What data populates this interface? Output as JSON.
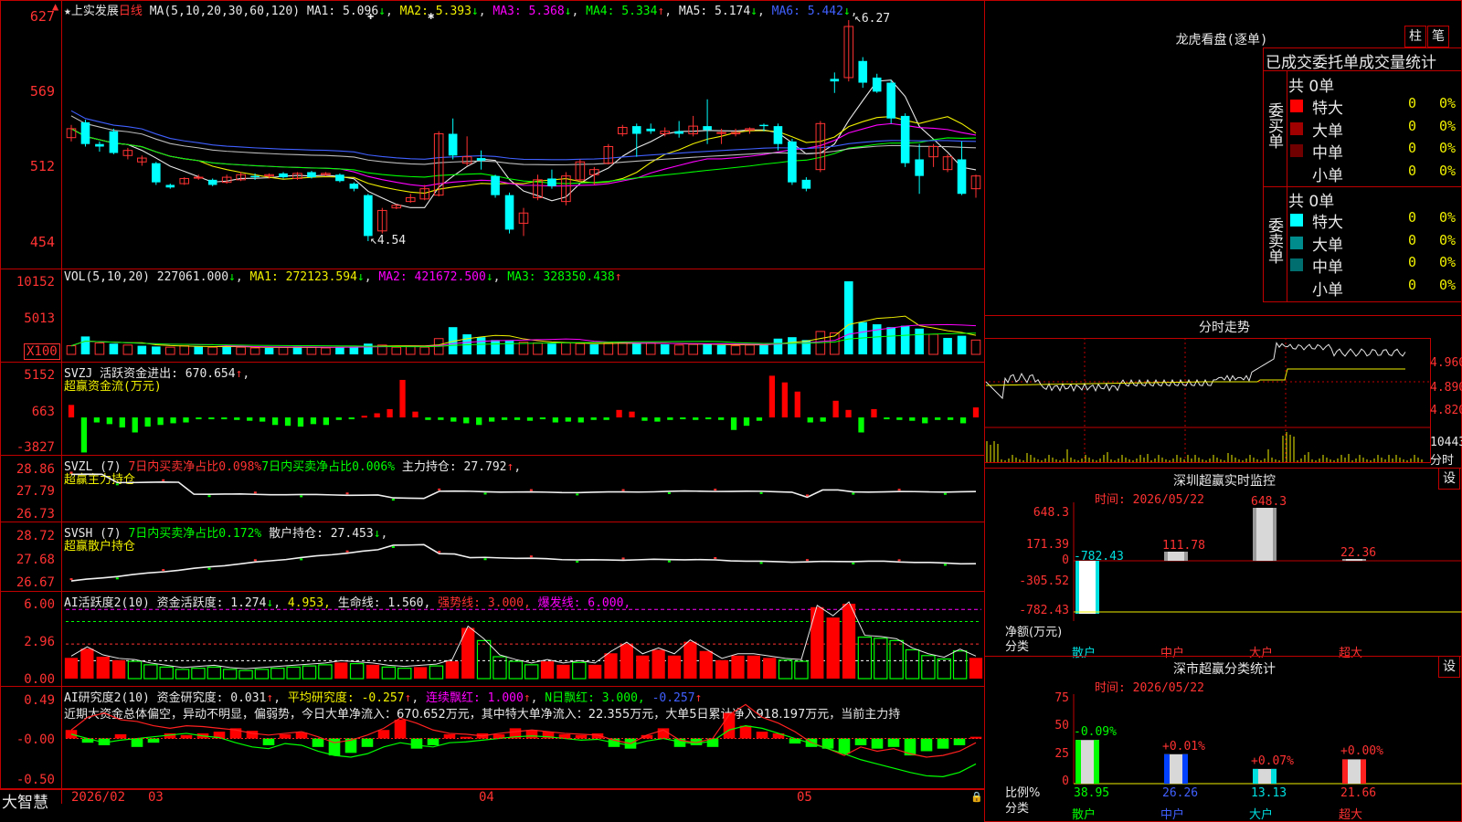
{
  "stock": {
    "name": "上实发展",
    "period": "日线",
    "star": "★"
  },
  "main": {
    "ma_label": "MA(5,10,20,30,60,120)",
    "ma": [
      {
        "label": "MA1:",
        "value": "5.096",
        "arrow": "↓",
        "color": "#e8e8e8"
      },
      {
        "label": "MA2:",
        "value": "5.393",
        "arrow": "↓",
        "color": "#f0f000"
      },
      {
        "label": "MA3:",
        "value": "5.368",
        "arrow": "↓",
        "color": "#ff00ff"
      },
      {
        "label": "MA4:",
        "value": "5.334",
        "arrow": "↑",
        "color": "#00ff00"
      },
      {
        "label": "MA5:",
        "value": "5.174",
        "arrow": "↓",
        "color": "#e8e8e8"
      },
      {
        "label": "MA6:",
        "value": "5.442",
        "arrow": "↓",
        "color": "#4060ff"
      }
    ],
    "yticks": [
      "627",
      "569",
      "512",
      "454"
    ],
    "high_marker": "6.27",
    "low_marker": "4.54"
  },
  "vol": {
    "header": "VOL(5,10,20)",
    "value": "227061.000",
    "ma1": "MA1: 272123.594",
    "ma2": "MA2: 421672.500",
    "ma3": "MA3: 328350.438",
    "a1": "↓",
    "a2": "↓",
    "a3": "↑",
    "yticks": [
      "10152",
      "5013",
      "X100"
    ]
  },
  "svzj": {
    "header": "SVZJ",
    "label": "活跃资金进出:",
    "value": "670.654",
    "arrow": "↑",
    "sub": "超赢资金流(万元)",
    "yticks": [
      "5152",
      "663",
      "-3827"
    ]
  },
  "svzl": {
    "header": "SVZL (7)",
    "p1": "7日内买卖净占比0.098%",
    "p2": "7日内买卖净占比0.006%",
    "label": "主力持仓:",
    "value": "27.792",
    "arrow": "↑",
    "sub": "超赢主力持仓",
    "yticks": [
      "28.86",
      "27.79",
      "26.73"
    ]
  },
  "svsh": {
    "header": "SVSH (7)",
    "p1": "7日内买卖净占比0.172%",
    "label": "散户持仓:",
    "value": "27.453",
    "arrow": "↓",
    "sub": "超赢散户持仓",
    "yticks": [
      "28.72",
      "27.68",
      "26.67"
    ]
  },
  "ai1": {
    "header": "AI活跃度2(10)",
    "label": "资金活跃度:",
    "value": "1.274",
    "arrow": "↓",
    "v2": "4.953,",
    "l3": "生命线:",
    "v3": "1.560,",
    "l4": "强势线:",
    "v4": "3.000,",
    "l5": "爆发线:",
    "v5": "6.000,",
    "yticks": [
      "6.00",
      "2.96",
      "0.00"
    ]
  },
  "ai2": {
    "header": "AI研究度2(10)",
    "label": "资金研究度:",
    "value": "0.031",
    "arrow": "↑",
    "l2": "平均研究度:",
    "v2": "-0.257",
    "l3": "连续飘红:",
    "v3": "1.000",
    "l4": "N日飘红:",
    "v4": "3.000,",
    "v5": "-0.257",
    "comment": "近期大资金总体偏空，异动不明显，偏弱势，今日大单净流入：670.652万元，其中特大单净流入：22.355万元，大单5日累计净入918.197万元，当前主力持",
    "yticks": [
      "0.49",
      "-0.00",
      "-0.50"
    ]
  },
  "dates": [
    "2026/02",
    "03",
    "04",
    "05"
  ],
  "brand": "大智慧",
  "right": {
    "lhb_title": "龙虎看盘(逐单)",
    "btn_zhu": "柱",
    "btn_bi": "笔",
    "tabs": "已成交委托单成交量统计",
    "buy": {
      "side": "委买单",
      "total": "共 0单",
      "rows": [
        {
          "label": "特大",
          "v": "0",
          "p": "0%",
          "c": "#ff0000"
        },
        {
          "label": "大单",
          "v": "0",
          "p": "0%",
          "c": "#a00000"
        },
        {
          "label": "中单",
          "v": "0",
          "p": "0%",
          "c": "#700000"
        },
        {
          "label": "小单",
          "v": "0",
          "p": "0%",
          "c": "#000000"
        }
      ]
    },
    "sell": {
      "side": "委卖单",
      "total": "共 0单",
      "rows": [
        {
          "label": "特大",
          "v": "0",
          "p": "0%",
          "c": "#00ffff"
        },
        {
          "label": "大单",
          "v": "0",
          "p": "0%",
          "c": "#008c8c"
        },
        {
          "label": "中单",
          "v": "0",
          "p": "0%",
          "c": "#006e6e"
        },
        {
          "label": "小单",
          "v": "0",
          "p": "0%",
          "c": "#000000"
        }
      ]
    },
    "fs_title": "分时走势",
    "fs_yticks": [
      "4.960",
      "4.890",
      "4.820"
    ],
    "fs_vol": "10443",
    "fs_vol_label": "分时",
    "sz_title": "深圳超赢实时监控",
    "sz_btn": "设",
    "sz_time": "时间: 2026/05/22",
    "sz_yticks": [
      "648.3",
      "171.39",
      "0",
      "-305.52",
      "-782.43"
    ],
    "sz_bars": [
      {
        "cat": "散户",
        "val": "-782.43"
      },
      {
        "cat": "中户",
        "val": "111.78"
      },
      {
        "cat": "大户",
        "val": "648.3"
      },
      {
        "cat": "超大",
        "val": "22.36"
      }
    ],
    "sz_axis1": "净额(万元)",
    "sz_axis2": "分类",
    "sc_title": "深市超赢分类统计",
    "sc_btn": "设",
    "sc_time": "时间: 2026/05/22",
    "sc_yticks": [
      "75",
      "50",
      "25",
      "0"
    ],
    "sc_bars": [
      {
        "cat": "散户",
        "val": "38.95",
        "chg": "-0.09%"
      },
      {
        "cat": "中户",
        "val": "26.26",
        "chg": "+0.01%"
      },
      {
        "cat": "大户",
        "val": "13.13",
        "chg": "+0.07%"
      },
      {
        "cat": "超大",
        "val": "21.66",
        "chg": "+0.00%"
      }
    ],
    "sc_axis1": "比例%",
    "sc_axis2": "分类"
  },
  "candles": [
    [
      5.35,
      5.42,
      5.45,
      5.32
    ],
    [
      5.47,
      5.3,
      5.49,
      5.28
    ],
    [
      5.3,
      5.28,
      5.32,
      5.24
    ],
    [
      5.4,
      5.23,
      5.42,
      5.22
    ],
    [
      5.21,
      5.25,
      5.27,
      5.18
    ],
    [
      5.16,
      5.19,
      5.21,
      5.13
    ],
    [
      5.15,
      5.0,
      5.16,
      4.98
    ],
    [
      4.98,
      4.96,
      4.99,
      4.95
    ],
    [
      4.99,
      5.03,
      5.04,
      4.98
    ],
    [
      5.04,
      5.04,
      5.06,
      5.02
    ],
    [
      5.02,
      4.98,
      5.03,
      4.97
    ],
    [
      5.0,
      5.04,
      5.06,
      4.99
    ],
    [
      5.02,
      5.06,
      5.08,
      5.01
    ],
    [
      5.05,
      5.04,
      5.07,
      5.02
    ],
    [
      5.05,
      5.06,
      5.07,
      5.03
    ],
    [
      5.07,
      5.04,
      5.08,
      5.03
    ],
    [
      5.03,
      5.07,
      5.08,
      5.02
    ],
    [
      5.08,
      5.04,
      5.09,
      5.03
    ],
    [
      5.06,
      5.07,
      5.08,
      5.05
    ],
    [
      5.06,
      5.01,
      5.07,
      5.0
    ],
    [
      4.99,
      4.95,
      5.0,
      4.93
    ],
    [
      4.9,
      4.58,
      4.91,
      4.54
    ],
    [
      4.62,
      4.78,
      4.8,
      4.6
    ],
    [
      4.8,
      4.82,
      4.83,
      4.79
    ],
    [
      4.85,
      4.88,
      4.91,
      4.84
    ],
    [
      4.87,
      4.95,
      4.98,
      4.86
    ],
    [
      4.9,
      5.38,
      5.4,
      4.89
    ],
    [
      5.38,
      5.21,
      5.5,
      5.18
    ],
    [
      5.15,
      5.2,
      5.36,
      5.13
    ],
    [
      5.19,
      5.17,
      5.25,
      5.1
    ],
    [
      5.05,
      4.9,
      5.06,
      4.88
    ],
    [
      4.9,
      4.63,
      4.92,
      4.6
    ],
    [
      4.68,
      4.76,
      4.8,
      4.58
    ],
    [
      4.88,
      5.02,
      5.06,
      4.86
    ],
    [
      5.03,
      4.97,
      5.1,
      4.95
    ],
    [
      4.85,
      5.05,
      5.08,
      4.82
    ],
    [
      5.02,
      5.16,
      5.18,
      5.0
    ],
    [
      5.06,
      5.1,
      5.12,
      4.98
    ],
    [
      5.15,
      5.28,
      5.3,
      5.14
    ],
    [
      5.38,
      5.43,
      5.45,
      5.36
    ],
    [
      5.44,
      5.38,
      5.46,
      5.2
    ],
    [
      5.42,
      5.4,
      5.46,
      5.38
    ],
    [
      5.38,
      5.4,
      5.43,
      5.36
    ],
    [
      5.4,
      5.38,
      5.48,
      5.35
    ],
    [
      5.38,
      5.44,
      5.52,
      5.36
    ],
    [
      5.44,
      5.41,
      5.65,
      5.3
    ],
    [
      5.39,
      5.39,
      5.42,
      5.3
    ],
    [
      5.38,
      5.39,
      5.42,
      5.36
    ],
    [
      5.41,
      5.42,
      5.43,
      5.38
    ],
    [
      5.45,
      5.44,
      5.46,
      5.4
    ],
    [
      5.44,
      5.3,
      5.46,
      5.25
    ],
    [
      5.32,
      5.0,
      5.34,
      4.98
    ],
    [
      5.02,
      4.95,
      5.04,
      4.93
    ],
    [
      5.1,
      5.46,
      5.48,
      5.08
    ],
    [
      5.81,
      5.79,
      5.86,
      5.7
    ],
    [
      5.82,
      6.22,
      6.27,
      5.79
    ],
    [
      5.95,
      5.78,
      5.98,
      5.74
    ],
    [
      5.82,
      5.71,
      5.85,
      5.7
    ],
    [
      5.78,
      5.5,
      5.8,
      5.46
    ],
    [
      5.52,
      5.15,
      5.54,
      5.12
    ],
    [
      5.18,
      5.05,
      5.3,
      4.91
    ],
    [
      5.2,
      5.28,
      5.3,
      5.12
    ],
    [
      5.1,
      5.2,
      5.22,
      5.08
    ],
    [
      5.18,
      4.91,
      5.32,
      4.9
    ],
    [
      4.95,
      5.05,
      5.06,
      4.88
    ]
  ],
  "vol_bars": [
    [
      1.2,
      1
    ],
    [
      2.5,
      0
    ],
    [
      1.6,
      1
    ],
    [
      1.5,
      0
    ],
    [
      1.3,
      1
    ],
    [
      1.2,
      0
    ],
    [
      1.1,
      0
    ],
    [
      1.0,
      1
    ],
    [
      1.2,
      1
    ],
    [
      1.1,
      0
    ],
    [
      1.0,
      1
    ],
    [
      1.1,
      0
    ],
    [
      1.0,
      1
    ],
    [
      0.9,
      1
    ],
    [
      0.9,
      0
    ],
    [
      1.0,
      1
    ],
    [
      1.1,
      0
    ],
    [
      1.0,
      1
    ],
    [
      0.9,
      1
    ],
    [
      1.0,
      0
    ],
    [
      1.1,
      0
    ],
    [
      1.5,
      0
    ],
    [
      1.3,
      1
    ],
    [
      1.0,
      1
    ],
    [
      1.1,
      1
    ],
    [
      1.0,
      1
    ],
    [
      2.2,
      1
    ],
    [
      3.8,
      0
    ],
    [
      2.8,
      0
    ],
    [
      2.4,
      0
    ],
    [
      2.0,
      0
    ],
    [
      1.9,
      0
    ],
    [
      1.7,
      1
    ],
    [
      1.6,
      1
    ],
    [
      1.5,
      0
    ],
    [
      1.6,
      1
    ],
    [
      1.5,
      1
    ],
    [
      1.4,
      0
    ],
    [
      1.6,
      1
    ],
    [
      1.7,
      1
    ],
    [
      1.5,
      0
    ],
    [
      1.6,
      1
    ],
    [
      1.4,
      0
    ],
    [
      1.3,
      1
    ],
    [
      1.4,
      1
    ],
    [
      1.5,
      0
    ],
    [
      1.3,
      0
    ],
    [
      1.2,
      1
    ],
    [
      1.3,
      1
    ],
    [
      1.3,
      0
    ],
    [
      2.2,
      0
    ],
    [
      2.4,
      0
    ],
    [
      2.0,
      0
    ],
    [
      3.2,
      1
    ],
    [
      3.0,
      1
    ],
    [
      10.2,
      0
    ],
    [
      4.5,
      0
    ],
    [
      4.2,
      0
    ],
    [
      3.8,
      0
    ],
    [
      4.0,
      0
    ],
    [
      3.6,
      0
    ],
    [
      2.8,
      1
    ],
    [
      2.3,
      0
    ],
    [
      2.6,
      0
    ],
    [
      2.0,
      1
    ]
  ],
  "flow": [
    1500,
    -4200,
    -600,
    -800,
    -1200,
    -1800,
    -1100,
    -900,
    -700,
    -600,
    -200,
    -100,
    -200,
    -300,
    -400,
    -500,
    -900,
    -1000,
    -1100,
    -800,
    -900,
    -300,
    -200,
    200,
    500,
    1000,
    4500,
    700,
    -300,
    -300,
    -500,
    -700,
    -900,
    -500,
    -300,
    -300,
    -400,
    -200,
    -600,
    -500,
    -600,
    -300,
    -300,
    900,
    700,
    -400,
    -500,
    -300,
    -200,
    -300,
    -200,
    -300,
    -1500,
    -1000,
    -400,
    5000,
    4200,
    3100,
    -600,
    -500,
    2000,
    900,
    -1800,
    1000,
    -200,
    -300,
    -400,
    -700,
    -300,
    -300,
    -700,
    1200
  ],
  "ai_bars": [
    [
      1.8,
      1
    ],
    [
      2.6,
      1
    ],
    [
      1.9,
      1
    ],
    [
      1.6,
      1
    ],
    [
      1.5,
      0
    ],
    [
      1.2,
      0
    ],
    [
      1.0,
      0
    ],
    [
      0.8,
      0
    ],
    [
      0.9,
      0
    ],
    [
      1.0,
      0
    ],
    [
      0.8,
      0
    ],
    [
      0.7,
      0
    ],
    [
      0.8,
      0
    ],
    [
      0.9,
      0
    ],
    [
      1.0,
      0
    ],
    [
      1.1,
      0
    ],
    [
      1.2,
      0
    ],
    [
      1.4,
      1
    ],
    [
      1.3,
      0
    ],
    [
      1.2,
      1
    ],
    [
      1.0,
      0
    ],
    [
      0.9,
      0
    ],
    [
      1.0,
      1
    ],
    [
      1.1,
      0
    ],
    [
      1.5,
      1
    ],
    [
      4.4,
      1
    ],
    [
      3.3,
      0
    ],
    [
      1.9,
      0
    ],
    [
      1.5,
      0
    ],
    [
      1.2,
      0
    ],
    [
      1.5,
      1
    ],
    [
      1.2,
      1
    ],
    [
      1.4,
      0
    ],
    [
      1.2,
      1
    ],
    [
      2.2,
      1
    ],
    [
      3.0,
      1
    ],
    [
      2.0,
      1
    ],
    [
      2.5,
      1
    ],
    [
      2.0,
      1
    ],
    [
      3.2,
      1
    ],
    [
      2.4,
      1
    ],
    [
      1.6,
      1
    ],
    [
      2.0,
      1
    ],
    [
      2.0,
      1
    ],
    [
      1.8,
      1
    ],
    [
      1.6,
      0
    ],
    [
      1.5,
      0
    ],
    [
      6.2,
      1
    ],
    [
      5.3,
      1
    ],
    [
      6.5,
      1
    ],
    [
      3.6,
      0
    ],
    [
      3.5,
      0
    ],
    [
      3.3,
      0
    ],
    [
      2.5,
      0
    ],
    [
      2.0,
      0
    ],
    [
      1.7,
      0
    ],
    [
      2.4,
      0
    ],
    [
      1.8,
      1
    ]
  ],
  "ai2_bars": [
    [
      0.1,
      1
    ],
    [
      -0.05,
      0
    ],
    [
      -0.08,
      0
    ],
    [
      0.05,
      1
    ],
    [
      -0.1,
      0
    ],
    [
      -0.05,
      0
    ],
    [
      0.06,
      1
    ],
    [
      0.04,
      1
    ],
    [
      0.06,
      1
    ],
    [
      0.08,
      1
    ],
    [
      0.12,
      1
    ],
    [
      0.09,
      1
    ],
    [
      -0.08,
      0
    ],
    [
      0.05,
      1
    ],
    [
      0.07,
      1
    ],
    [
      -0.1,
      0
    ],
    [
      -0.2,
      0
    ],
    [
      -0.17,
      0
    ],
    [
      -0.1,
      0
    ],
    [
      0.1,
      1
    ],
    [
      0.22,
      1
    ],
    [
      -0.12,
      0
    ],
    [
      -0.08,
      0
    ],
    [
      0.05,
      1
    ],
    [
      0.02,
      1
    ],
    [
      0.06,
      1
    ],
    [
      0.05,
      1
    ],
    [
      0.12,
      1
    ],
    [
      0.1,
      1
    ],
    [
      0.08,
      1
    ],
    [
      0.05,
      1
    ],
    [
      0.04,
      1
    ],
    [
      0.06,
      1
    ],
    [
      -0.1,
      0
    ],
    [
      -0.12,
      0
    ],
    [
      0.04,
      1
    ],
    [
      0.12,
      1
    ],
    [
      -0.1,
      0
    ],
    [
      -0.08,
      0
    ],
    [
      -0.1,
      0
    ],
    [
      0.3,
      1
    ],
    [
      0.15,
      1
    ],
    [
      0.08,
      1
    ],
    [
      0.06,
      1
    ],
    [
      -0.06,
      0
    ],
    [
      -0.1,
      0
    ],
    [
      -0.12,
      0
    ],
    [
      -0.18,
      0
    ],
    [
      -0.08,
      0
    ],
    [
      -0.12,
      0
    ],
    [
      -0.1,
      0
    ],
    [
      -0.2,
      0
    ],
    [
      -0.15,
      0
    ],
    [
      -0.12,
      0
    ],
    [
      -0.08,
      0
    ],
    [
      0.02,
      1
    ]
  ]
}
